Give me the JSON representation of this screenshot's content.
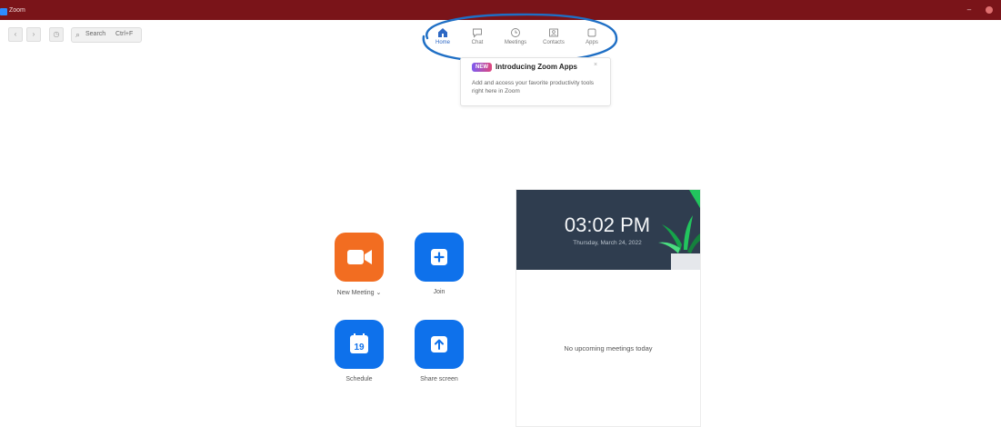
{
  "window": {
    "title": "Zoom",
    "minimize_glyph": "–"
  },
  "toolbar": {
    "back_glyph": "‹",
    "forward_glyph": "›",
    "history_glyph": "◷",
    "search_label": "Search",
    "search_shortcut": "Ctrl+F"
  },
  "nav": {
    "tabs": [
      {
        "label": "Home",
        "icon": "home-icon",
        "active": true
      },
      {
        "label": "Chat",
        "icon": "chat-icon",
        "active": false
      },
      {
        "label": "Meetings",
        "icon": "clock-icon",
        "active": false
      },
      {
        "label": "Contacts",
        "icon": "contacts-icon",
        "active": false
      },
      {
        "label": "Apps",
        "icon": "apps-icon",
        "active": false
      }
    ]
  },
  "popup": {
    "badge": "NEW",
    "title": "Introducing Zoom Apps",
    "close_glyph": "×",
    "description": "Add and access your favorite productivity tools right here in Zoom"
  },
  "actions": {
    "new_meeting": {
      "label": "New Meeting ⌄",
      "icon": "video-camera-icon"
    },
    "join": {
      "label": "Join",
      "icon": "plus-icon"
    },
    "schedule": {
      "label": "Schedule",
      "icon": "calendar-icon",
      "day": "19"
    },
    "share_screen": {
      "label": "Share screen",
      "icon": "share-arrow-icon"
    }
  },
  "calendar": {
    "time": "03:02 PM",
    "date": "Thursday, March 24, 2022",
    "empty_message": "No upcoming meetings today"
  },
  "colors": {
    "titlebar": "#7a1419",
    "brand_blue": "#0e71eb",
    "orange": "#f26d21",
    "card_header": "#2f3d4f",
    "annotation": "#1f6fc5"
  }
}
